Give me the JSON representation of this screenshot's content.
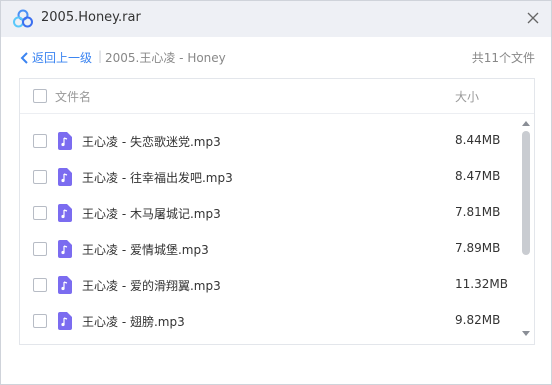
{
  "window": {
    "title": "2005.Honey.rar",
    "close_glyph": "×"
  },
  "nav": {
    "back_label": "返回上一级",
    "separator": "|",
    "path": "2005.王心凌 - Honey",
    "total": "共11个文件"
  },
  "columns": {
    "name": "文件名",
    "size": "大小"
  },
  "files": [
    {
      "name": "王心凌 - 失恋歌迷党.mp3",
      "size": "8.44MB"
    },
    {
      "name": "王心凌 - 往幸福出发吧.mp3",
      "size": "8.47MB"
    },
    {
      "name": "王心凌 - 木马屠城记.mp3",
      "size": "7.81MB"
    },
    {
      "name": "王心凌 - 爱情城堡.mp3",
      "size": "7.89MB"
    },
    {
      "name": "王心凌 - 爱的滑翔翼.mp3",
      "size": "11.32MB"
    },
    {
      "name": "王心凌 - 翅膀.mp3",
      "size": "9.82MB"
    }
  ],
  "icons": {
    "logo": "app-logo-icon",
    "back": "chevron-left-icon",
    "file": "audio-file-icon",
    "close": "close-icon"
  },
  "colors": {
    "accent": "#3b84f1",
    "file_icon": "#7b6cf0",
    "titlebar": "#eef0f5"
  }
}
